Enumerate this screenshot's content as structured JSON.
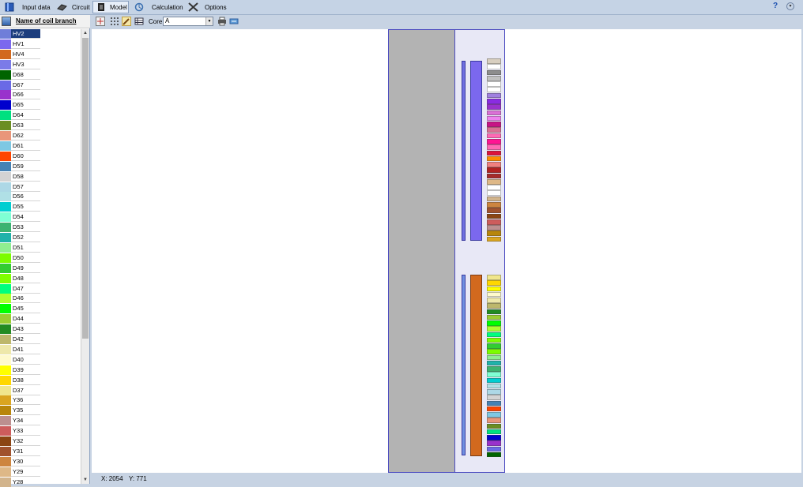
{
  "toolbar": {
    "items": [
      {
        "label": "Input data",
        "x": 0
      },
      {
        "label": "Circuit",
        "x": 1
      },
      {
        "label": "Model",
        "x": 2,
        "active": true
      },
      {
        "label": "Calculation",
        "x": 3
      },
      {
        "label": "Options",
        "x": 4
      }
    ],
    "help": "?"
  },
  "left_panel": {
    "header": "Name of coil branch",
    "rows": [
      {
        "name": "HV2",
        "color": "#6f7ed9",
        "selected": true
      },
      {
        "name": "HV1",
        "color": "#7b68ee"
      },
      {
        "name": "HV4",
        "color": "#d2691e"
      },
      {
        "name": "HV3",
        "color": "#7b7be8"
      },
      {
        "name": "D68",
        "color": "#006400"
      },
      {
        "name": "D67",
        "color": "#6a6ae6"
      },
      {
        "name": "D66",
        "color": "#9932cc"
      },
      {
        "name": "D65",
        "color": "#0000cd"
      },
      {
        "name": "D64",
        "color": "#00e080"
      },
      {
        "name": "D63",
        "color": "#6b8e23"
      },
      {
        "name": "D62",
        "color": "#e9967a"
      },
      {
        "name": "D61",
        "color": "#7ec8e3"
      },
      {
        "name": "D60",
        "color": "#ff4500"
      },
      {
        "name": "D59",
        "color": "#4682b4"
      },
      {
        "name": "D58",
        "color": "#d3d3d3"
      },
      {
        "name": "D57",
        "color": "#add8e6"
      },
      {
        "name": "D56",
        "color": "#b0e0e6"
      },
      {
        "name": "D55",
        "color": "#00ced1"
      },
      {
        "name": "D54",
        "color": "#7fffd4"
      },
      {
        "name": "D53",
        "color": "#3cb371"
      },
      {
        "name": "D52",
        "color": "#20b2aa"
      },
      {
        "name": "D51",
        "color": "#90ee90"
      },
      {
        "name": "D50",
        "color": "#7cfc00"
      },
      {
        "name": "D49",
        "color": "#32cd32"
      },
      {
        "name": "D48",
        "color": "#7fff00"
      },
      {
        "name": "D47",
        "color": "#00ff7f"
      },
      {
        "name": "D46",
        "color": "#adff2f"
      },
      {
        "name": "D45",
        "color": "#00ff00"
      },
      {
        "name": "D44",
        "color": "#9acd32"
      },
      {
        "name": "D43",
        "color": "#228b22"
      },
      {
        "name": "D42",
        "color": "#bdb76b"
      },
      {
        "name": "D41",
        "color": "#eee8aa"
      },
      {
        "name": "D40",
        "color": "#fffacd"
      },
      {
        "name": "D39",
        "color": "#ffff00"
      },
      {
        "name": "D38",
        "color": "#ffd700"
      },
      {
        "name": "D37",
        "color": "#f0e68c"
      },
      {
        "name": "Y36",
        "color": "#daa520"
      },
      {
        "name": "Y35",
        "color": "#b8860b"
      },
      {
        "name": "Y34",
        "color": "#bc8f8f"
      },
      {
        "name": "Y33",
        "color": "#cd5c5c"
      },
      {
        "name": "Y32",
        "color": "#8b4513"
      },
      {
        "name": "Y31",
        "color": "#a0522d"
      },
      {
        "name": "Y30",
        "color": "#cd853f"
      },
      {
        "name": "Y29",
        "color": "#deb887"
      },
      {
        "name": "Y28",
        "color": "#d2b48c"
      }
    ]
  },
  "model_toolbar": {
    "core_label": "Core",
    "core_value": "A"
  },
  "status": {
    "x_text": "X: 2054",
    "y_text": "Y: 771"
  },
  "model": {
    "core_color": "#b3b3b3",
    "window_color": "#e8e8f6",
    "outline_color": "#4b4bc0",
    "upper_inner_bar_color": "#6f6fe0",
    "upper_main_coil_color": "#7b68ee",
    "lower_inner_bar_color": "#6f8fe0",
    "lower_main_coil_color": "#d2691e",
    "upper_stack_colors": [
      "#d8cfc0",
      "#ffffff",
      "#8d8d8d",
      "#c0c0c0",
      "#ffffff",
      "#ffffff",
      "#a080e0",
      "#8a2be2",
      "#9932cc",
      "#da70d6",
      "#ee82ee",
      "#c71585",
      "#db7093",
      "#ff69b4",
      "#ff1493",
      "#ff69b4",
      "#dc143c",
      "#ff8c00",
      "#f08080",
      "#b22222",
      "#a52a2a",
      "#deb887",
      "#ffffff",
      "#ffffff",
      "#d2b48c",
      "#cd853f",
      "#a0522d",
      "#8b4513",
      "#cd5c5c",
      "#bc8f8f",
      "#b8860b",
      "#daa520"
    ],
    "lower_stack_colors": [
      "#f0e68c",
      "#ffd700",
      "#ffff00",
      "#fffacd",
      "#eee8aa",
      "#bdb76b",
      "#228b22",
      "#9acd32",
      "#00ff00",
      "#adff2f",
      "#00ff7f",
      "#7fff00",
      "#32cd32",
      "#7cfc00",
      "#90ee90",
      "#20b2aa",
      "#3cb371",
      "#7fffd4",
      "#00ced1",
      "#b0e0e6",
      "#add8e6",
      "#d3d3d3",
      "#4682b4",
      "#ff4500",
      "#7ec8e3",
      "#e9967a",
      "#6b8e23",
      "#00e080",
      "#0000cd",
      "#9932cc",
      "#6a6ae6",
      "#006400"
    ]
  }
}
